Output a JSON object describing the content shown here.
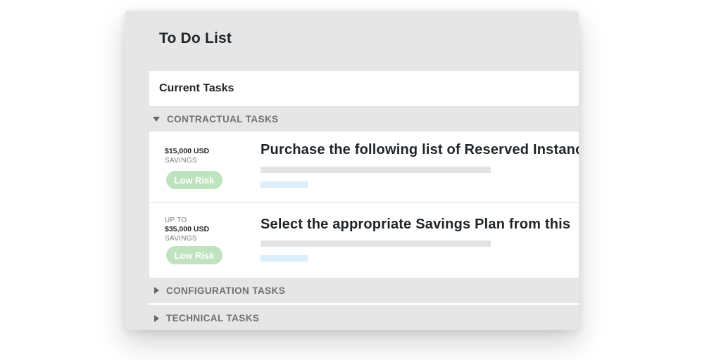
{
  "panel": {
    "title": "To Do List",
    "current_tab": "Current Tasks"
  },
  "sections": {
    "contractual": "CONTRACTUAL TASKS",
    "configuration": "CONFIGURATION TASKS",
    "technical": "TECHNICAL TASKS"
  },
  "tasks": [
    {
      "prefix": "",
      "amount": "$15,000 USD",
      "savings_label": "SAVINGS",
      "risk": "Low Risk",
      "title": "Purchase the following list of Reserved Instanc"
    },
    {
      "prefix": "UP TO",
      "amount": "$35,000 USD",
      "savings_label": "SAVINGS",
      "risk": "Low Risk",
      "title": "Select the appropriate Savings Plan from this"
    }
  ],
  "colors": {
    "panel_bg": "#e6e6e6",
    "badge_bg": "#bfe3bf",
    "placeholder_blue": "#dbeef9",
    "placeholder_gray": "#e3e3e3"
  }
}
